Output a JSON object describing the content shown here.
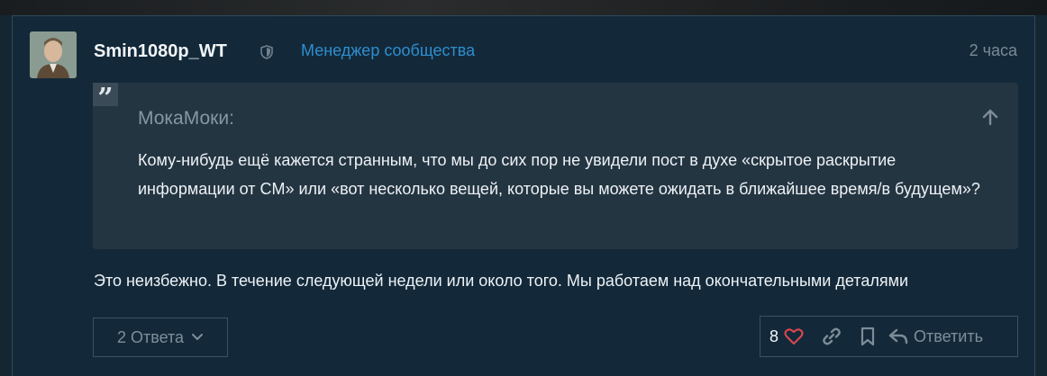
{
  "post": {
    "username": "Smin1080p_WT",
    "role": "Менеджер сообщества",
    "time": "2 часа",
    "quote": {
      "author": "МокаМоки:",
      "text": "Кому-нибудь ещё кажется странным, что мы до сих пор не увидели пост в духе «скрытое раскрытие информации от CM» или «вот несколько вещей, которые вы можете ожидать в ближайшее время/в будущем»?"
    },
    "body": "Это неизбежно. В течение следующей недели или около того. Мы работаем над окончательными деталями",
    "replies_label": "2 Ответа",
    "like_count": "8",
    "reply_label": "Ответить"
  },
  "colors": {
    "accent": "#2e8ecf",
    "heart": "#e0484e",
    "background": "#13293a",
    "quote_background": "#243542"
  },
  "icons": [
    "shield-icon",
    "quote-mark-icon",
    "arrow-up-icon",
    "chevron-down-icon",
    "heart-icon",
    "link-icon",
    "bookmark-icon",
    "reply-arrow-icon"
  ]
}
